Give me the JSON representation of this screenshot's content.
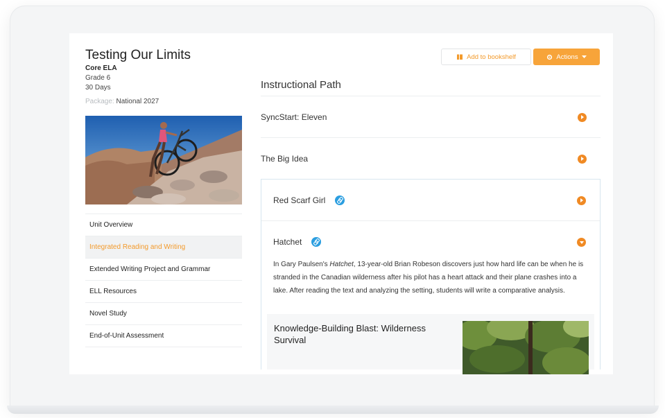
{
  "unit": {
    "title": "Testing Our Limits",
    "course": "Core ELA",
    "grade": "Grade 6",
    "days": "30 Days",
    "package_label": "Package:",
    "package_value": "National 2027"
  },
  "nav": {
    "items": [
      {
        "label": "Unit Overview",
        "active": false
      },
      {
        "label": "Integrated Reading and Writing",
        "active": true
      },
      {
        "label": "Extended Writing Project and Grammar",
        "active": false
      },
      {
        "label": "ELL Resources",
        "active": false
      },
      {
        "label": "Novel Study",
        "active": false
      },
      {
        "label": "End-of-Unit Assessment",
        "active": false
      }
    ]
  },
  "toolbar": {
    "bookshelf_label": "Add to bookshelf",
    "actions_label": "Actions"
  },
  "path": {
    "title": "Instructional Path",
    "items": [
      {
        "label": "SyncStart: Eleven"
      },
      {
        "label": "The Big Idea"
      },
      {
        "label": "Red Scarf Girl"
      },
      {
        "label": "Hatchet"
      }
    ],
    "hatchet_desc": {
      "before": "In Gary Paulsen's ",
      "italic": "Hatchet",
      "after": ", 13-year-old Brian Robeson discovers just how hard life can be when he is stranded in the Canadian wilderness after his pilot has a heart attack and their plane crashes into a lake. After reading the text and analyzing the setting, students will write a comparative analysis."
    },
    "knowledge_blast": "Knowledge-Building Blast: Wilderness Survival"
  },
  "colors": {
    "accent": "#f39a2b",
    "play": "#f08a24",
    "link": "#2b9ee0"
  }
}
